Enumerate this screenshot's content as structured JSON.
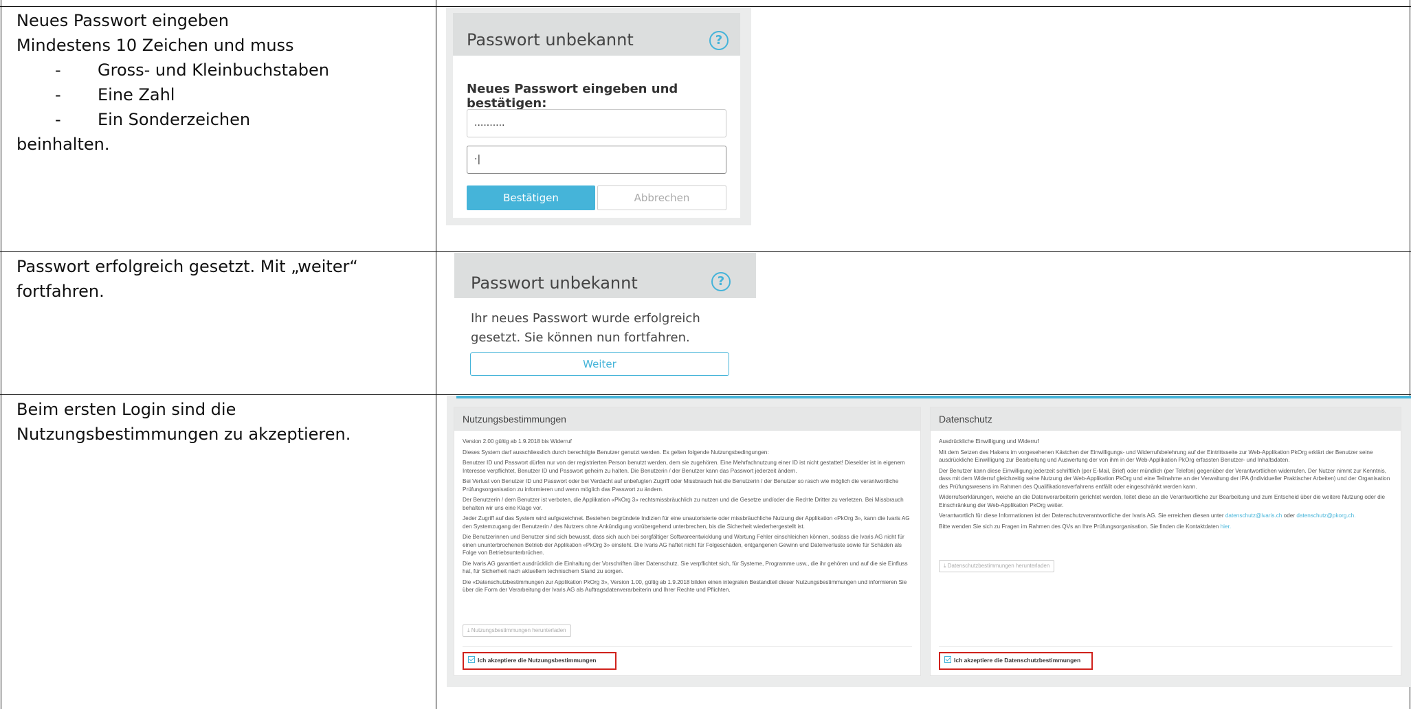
{
  "rows": [
    {
      "left_text": {
        "lines": [
          "Neues Passwort eingeben",
          "Mindestens 10 Zeichen und muss"
        ],
        "bullets": [
          "Gross- und Kleinbuchstaben",
          "Eine Zahl",
          "Ein Sonderzeichen"
        ],
        "bullet_marker": "-",
        "closing": "beinhalten."
      },
      "screenshot": {
        "title": "Passwort unbekannt",
        "help_icon": "question-circle-icon",
        "prompt": "Neues Passwort eingeben und bestätigen:",
        "password_value": "..........",
        "confirm_value": "·|",
        "confirm_button": "Bestätigen",
        "cancel_button": "Abbrechen"
      }
    },
    {
      "left_text": {
        "lines": [
          "Passwort erfolgreich gesetzt. Mit „weiter“",
          "fortfahren."
        ]
      },
      "screenshot": {
        "title": "Passwort unbekannt",
        "help_icon": "question-circle-icon",
        "message_lines": [
          "Ihr neues Passwort wurde erfolgreich",
          "gesetzt. Sie können nun fortfahren."
        ],
        "next_button": "Weiter"
      }
    },
    {
      "left_text": {
        "lines": [
          "Beim ersten Login sind die",
          "Nutzungsbestimmungen zu akzeptieren."
        ]
      },
      "screenshot": {
        "terms": {
          "title": "Nutzungsbestimmungen",
          "paragraphs": [
            "Version 2.00 gültig ab 1.9.2018 bis Widerruf",
            "Dieses System darf ausschliesslich durch berechtigte Benutzer genutzt werden. Es gelten folgende Nutzungsbedingungen:",
            "Benutzer ID und Passwort dürfen nur von der registrierten Person benutzt werden, dem sie zugehören. Eine Mehrfachnutzung einer ID ist nicht gestattet! Dieselder ist in eigenem Interesse verpflichtet, Benutzer ID und Passwort geheim zu halten. Die Benutzerin / der Benutzer kann das Passwort jederzeit ändern.",
            "Bei Verlust von Benutzer ID und Passwort oder bei Verdacht auf unbefugten Zugriff oder Missbrauch hat die Benutzerin / der Benutzer so rasch wie möglich die verantwortliche Prüfungsorganisation zu informieren und wenn möglich das Passwort zu ändern.",
            "Der Benutzerin / dem Benutzer ist verboten, die Applikation «PkOrg 3» rechtsmissbräuchlich zu nutzen und die Gesetze und/oder die Rechte Dritter zu verletzen. Bei Missbrauch behalten wir uns eine Klage vor.",
            "Jeder Zugriff auf das System wird aufgezeichnet. Bestehen begründete Indizien für eine unautorisierte oder missbräuchliche Nutzung der Applikation «PkOrg 3», kann die Ivaris AG den Systemzugang der Benutzerin / des Nutzers ohne Ankündigung vorübergehend unterbrechen, bis die Sicherheit wiederhergestellt ist.",
            "Die Benutzerinnen und Benutzer sind sich bewusst, dass sich auch bei sorgfältiger Softwareentwicklung und Wartung Fehler einschleichen können, sodass die Ivaris AG nicht für einen ununterbrochenen Betrieb der Applikation «PkOrg 3» einsteht. Die Ivaris AG haftet nicht für Folgeschäden, entgangenen Gewinn und Datenverluste sowie für Schäden als Folge von Betriebsunterbrüchen.",
            "Die Ivaris AG garantiert ausdrücklich die Einhaltung der Vorschriften über Datenschutz. Sie verpflichtet sich, für Systeme, Programme usw., die ihr gehören und auf die sie Einfluss hat, für Sicherheit nach aktuellem technischem Stand zu sorgen.",
            "Die «Datenschutzbestimmungen zur Applikation PkOrg 3», Version 1.00, gültig ab 1.9.2018 bilden einen integralen Bestandteil dieser Nutzungsbestimmungen und informieren Sie über die Form der Verarbeitung der Ivaris AG als Auftragsdatenverarbeiterin und Ihrer Rechte und Pflichten."
          ],
          "download_button": "Nutzungsbestimmungen herunterladen",
          "accept_label": "Ich akzeptiere die Nutzungsbestimmungen"
        },
        "privacy": {
          "title": "Datenschutz",
          "paragraphs": [
            "Ausdrückliche Einwilligung und Widerruf",
            "Mit dem Setzen des Hakens im vorgesehenen Kästchen der Einwilligungs- und Widerrufsbelehrung auf der Eintrittsseite zur Web-Applikation PkOrg erklärt der Benutzer seine ausdrückliche Einwilligung zur Bearbeitung und Auswertung der von ihm in der Web-Applikation PkOrg erfassten Benutzer- und Inhaltsdaten.",
            "Der Benutzer kann diese Einwilligung jederzeit schriftlich (per E-Mail, Brief) oder mündlich (per Telefon) gegenüber der Verantwortlichen widerrufen. Der Nutzer nimmt zur Kenntnis, dass mit dem Widerruf gleichzeitig seine Nutzung der Web-Applikation PkOrg und eine Teilnahme an der Verwaltung der IPA (Individueller Praktischer Arbeiten) und der Organisation des Prüfungswesens im Rahmen des Qualifikationsverfahrens entfällt oder eingeschränkt werden kann.",
            "Widerrufserklärungen, weiche an die Datenverarbeiterin gerichtet werden, leitet diese an die Verantwortliche zur Bearbeitung und zum Entscheid über die weitere Nutzung oder die Einschränkung der Web-Applikation PkOrg weiter."
          ],
          "contact_text": "Verantwortlich für diese Informationen ist der Datenschutzverantwortliche der Ivaris AG. Sie erreichen diesen unter",
          "contact_email_1": "datenschutz@ivaris.ch",
          "contact_or": "oder",
          "contact_email_2": "datenschutz@pkorg.ch.",
          "contact_questions": "Bitte wenden Sie sich zu Fragen im Rahmen des QVs an Ihre Prüfungsorganisation. Sie finden die Kontaktdaten",
          "contact_link": "hier.",
          "download_button": "Datenschutzbestimmungen herunterladen",
          "accept_label": "Ich akzeptiere die Datenschutzbestimmungen"
        },
        "accent_color": "#45b4d9",
        "highlight_color": "#d0211b"
      }
    }
  ]
}
